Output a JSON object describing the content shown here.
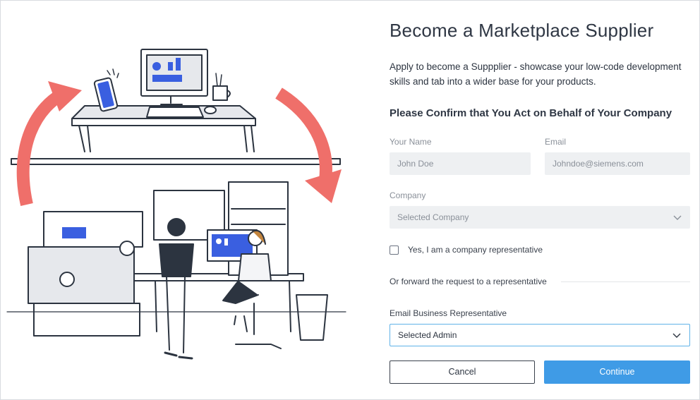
{
  "page": {
    "title": "Become a Marketplace Supplier",
    "description": "Apply to become a Suppplier - showcase your low-code development skills and tab into a wider base for your products.",
    "subheading": "Please Confirm that You Act on Behalf of Your Company"
  },
  "form": {
    "name": {
      "label": "Your Name",
      "placeholder": "John Doe"
    },
    "email": {
      "label": "Email",
      "placeholder": "Johndoe@siemens.com"
    },
    "company": {
      "label": "Company",
      "selected": "Selected Company"
    },
    "representative_checkbox": {
      "label": "Yes, I am a company representative",
      "checked": false
    },
    "forward_text": "Or forward the request to a representative",
    "business_rep": {
      "label": "Email Business Representative",
      "selected": "Selected Admin"
    }
  },
  "actions": {
    "cancel_label": "Cancel",
    "continue_label": "Continue"
  },
  "colors": {
    "accent": "#3f9be6",
    "active_border": "#5fb2e8",
    "arrow": "#ef6f6a",
    "screen_blue": "#3a5fe0"
  }
}
